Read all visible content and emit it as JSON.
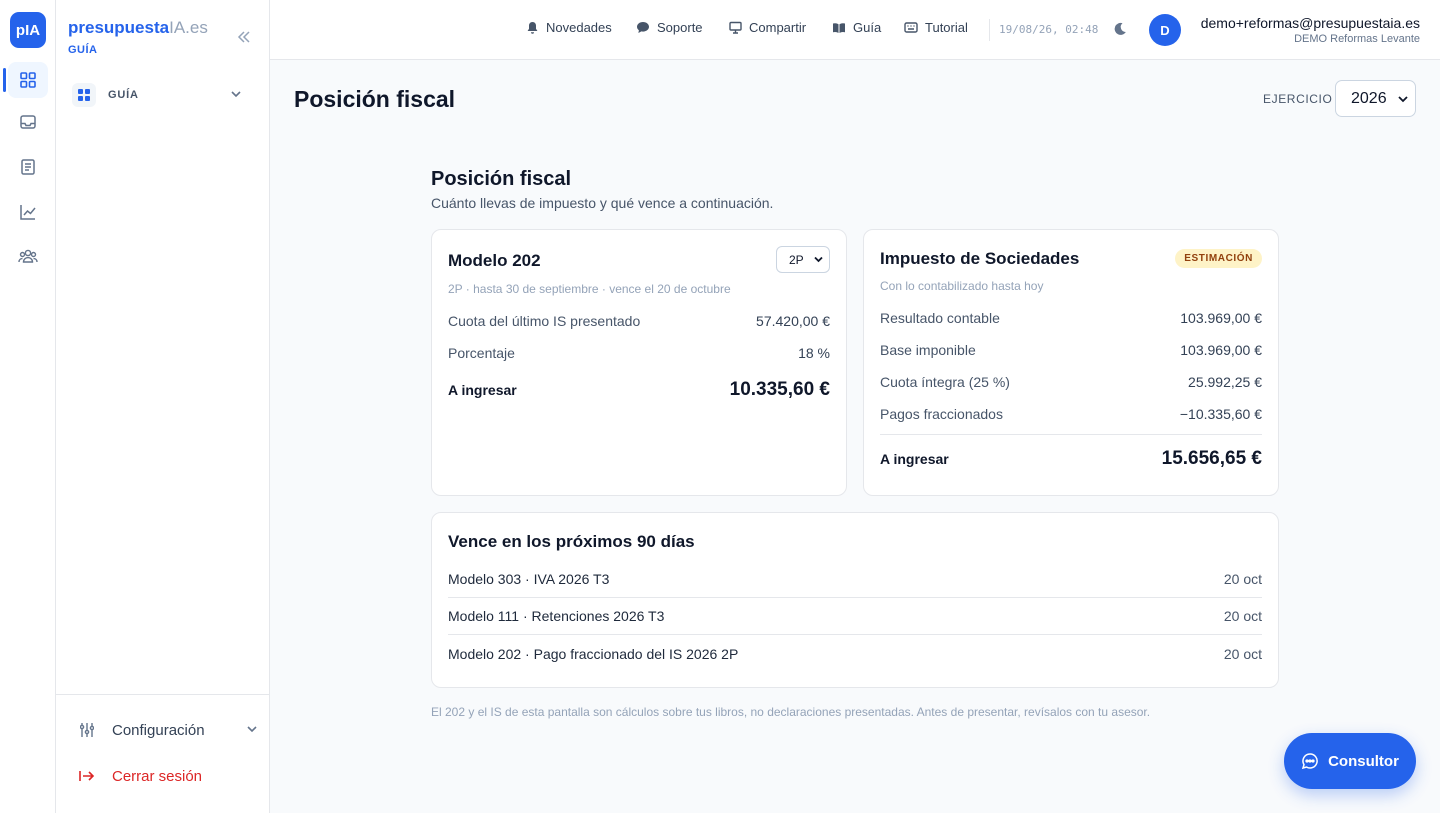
{
  "app": {
    "logo_text": "pIA",
    "brand_part1": "presupuesta",
    "brand_part2": "IA.es",
    "brand_sub": "GUÍA"
  },
  "rail": {
    "items": [
      {
        "icon": "dashboard-icon",
        "active": true
      },
      {
        "icon": "inbox-icon",
        "active": false
      },
      {
        "icon": "document-icon",
        "active": false
      },
      {
        "icon": "chart-line-icon",
        "active": false
      },
      {
        "icon": "team-icon",
        "active": false
      }
    ]
  },
  "sidebar": {
    "group_label": "GUÍA",
    "settings_label": "Configuración",
    "logout_label": "Cerrar sesión"
  },
  "topbar": {
    "nav": [
      {
        "label": "Novedades",
        "icon": "bell-icon"
      },
      {
        "label": "Soporte",
        "icon": "chat-bubble-icon"
      },
      {
        "label": "Compartir",
        "icon": "monitor-icon"
      },
      {
        "label": "Guía",
        "icon": "book-icon"
      },
      {
        "label": "Tutorial",
        "icon": "keyboard-icon"
      }
    ],
    "datetime": "19/08/26, 02:48",
    "avatar_initial": "D",
    "user_email": "demo+reformas@presupuestaia.es",
    "user_org": "DEMO Reformas Levante"
  },
  "page": {
    "title": "Posición fiscal",
    "ejercicio_label": "EJERCICIO",
    "ejercicio_value": "2026"
  },
  "section": {
    "title": "Posición fiscal",
    "subtitle": "Cuánto llevas de impuesto y qué vence a continuación."
  },
  "modelo202": {
    "title": "Modelo 202",
    "period": "2P",
    "subtitle": "2P · hasta 30 de septiembre · vence el 20 de octubre",
    "rows": [
      {
        "label": "Cuota del último IS presentado",
        "value": "57.420,00 €"
      },
      {
        "label": "Porcentaje",
        "value": "18 %"
      }
    ],
    "total_label": "A ingresar",
    "total_value": "10.335,60 €"
  },
  "sociedades": {
    "title": "Impuesto de Sociedades",
    "badge": "ESTIMACIÓN",
    "subtitle": "Con lo contabilizado hasta hoy",
    "rows": [
      {
        "label": "Resultado contable",
        "value": "103.969,00 €"
      },
      {
        "label": "Base imponible",
        "value": "103.969,00 €"
      },
      {
        "label": "Cuota íntegra (25 %)",
        "value": "25.992,25 €"
      },
      {
        "label": "Pagos fraccionados",
        "value": "−10.335,60 €"
      }
    ],
    "total_label": "A ingresar",
    "total_value": "15.656,65 €"
  },
  "due": {
    "title": "Vence en los próximos 90 días",
    "items": [
      {
        "label": "Modelo 303 · IVA 2026 T3",
        "date": "20 oct"
      },
      {
        "label": "Modelo 111 · Retenciones 2026 T3",
        "date": "20 oct"
      },
      {
        "label": "Modelo 202 · Pago fraccionado del IS 2026 2P",
        "date": "20 oct"
      }
    ]
  },
  "footer_note": "El 202 y el IS de esta pantalla son cálculos sobre tus libros, no declaraciones presentadas. Antes de presentar, revísalos con tu asesor.",
  "consultor_label": "Consultor",
  "colors": {
    "accent": "#2563eb",
    "danger": "#dc2626",
    "badge_bg": "#fef3c7",
    "badge_text": "#92400e"
  }
}
